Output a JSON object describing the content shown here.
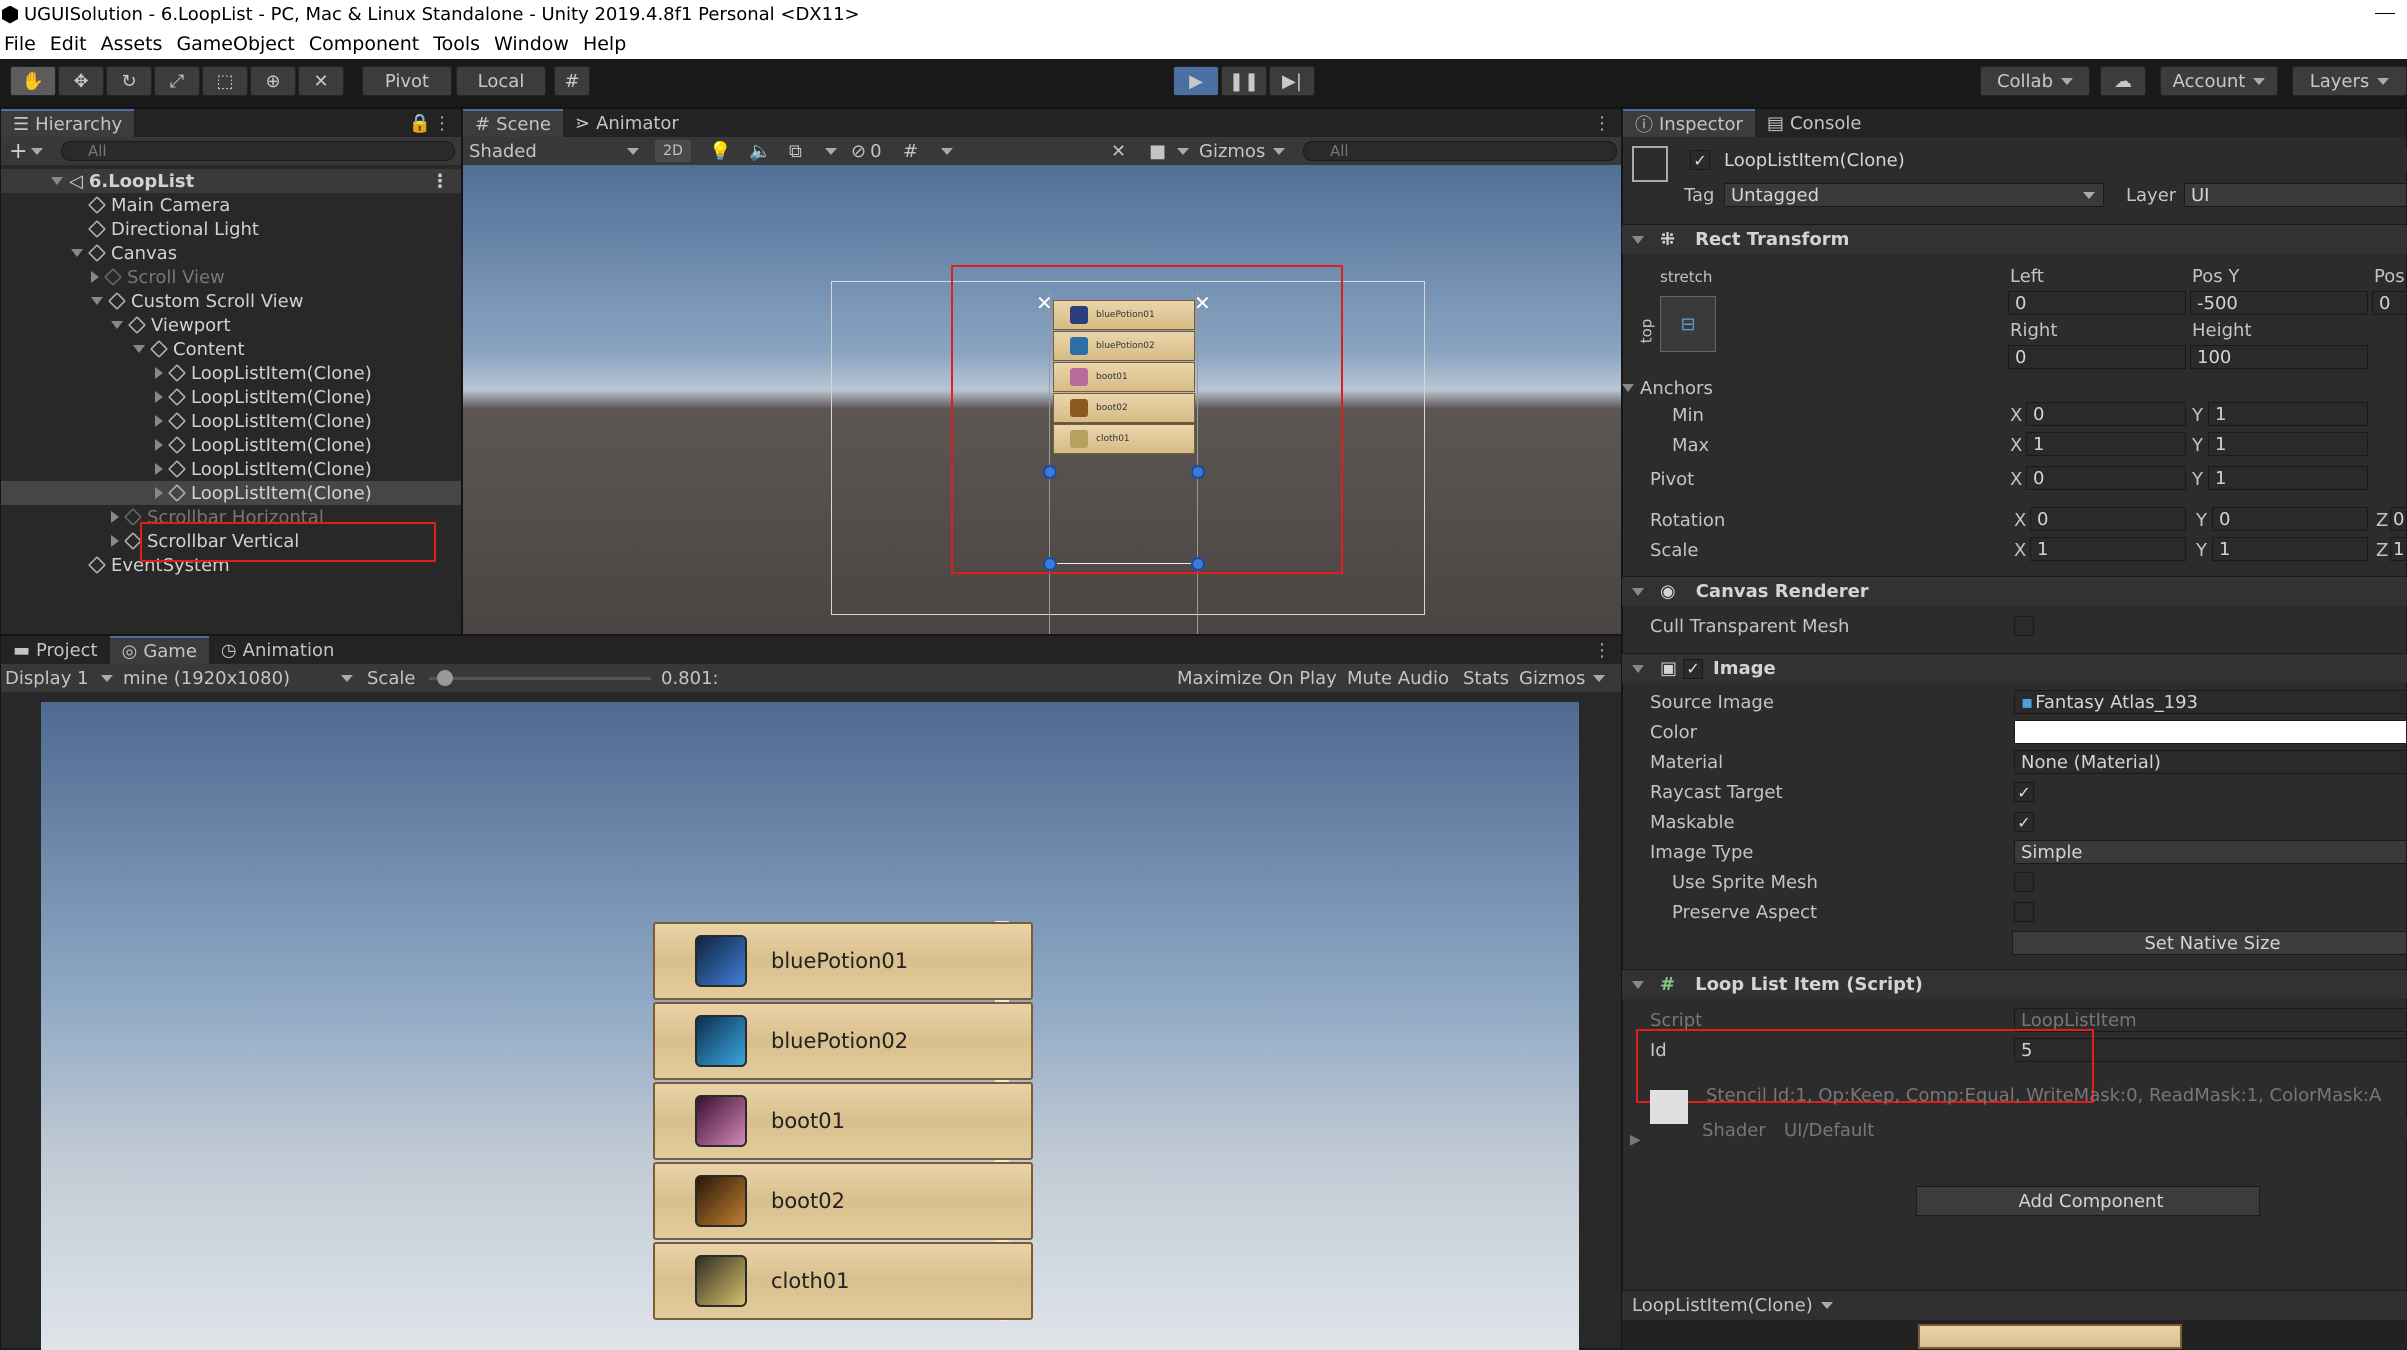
{
  "window": {
    "title": "UGUISolution - 6.LoopList - PC, Mac & Linux Standalone - Unity 2019.4.8f1 Personal <DX11>"
  },
  "menu": [
    "File",
    "Edit",
    "Assets",
    "GameObject",
    "Component",
    "Tools",
    "Window",
    "Help"
  ],
  "toolbar": {
    "pivot": "Pivot",
    "local": "Local",
    "collab": "Collab",
    "account": "Account",
    "layers": "Layers"
  },
  "hierarchy": {
    "tab": "Hierarchy",
    "search_placeholder": "All",
    "items": [
      {
        "label": "6.LoopList",
        "depth": 0
      },
      {
        "label": "Main Camera",
        "depth": 1
      },
      {
        "label": "Directional Light",
        "depth": 1
      },
      {
        "label": "Canvas",
        "depth": 1
      },
      {
        "label": "Scroll View",
        "depth": 2
      },
      {
        "label": "Custom Scroll View",
        "depth": 2
      },
      {
        "label": "Viewport",
        "depth": 3
      },
      {
        "label": "Content",
        "depth": 4
      },
      {
        "label": "LoopListItem(Clone)",
        "depth": 5
      },
      {
        "label": "LoopListItem(Clone)",
        "depth": 5
      },
      {
        "label": "LoopListItem(Clone)",
        "depth": 5
      },
      {
        "label": "LoopListItem(Clone)",
        "depth": 5
      },
      {
        "label": "LoopListItem(Clone)",
        "depth": 5
      },
      {
        "label": "LoopListItem(Clone)",
        "depth": 5
      },
      {
        "label": "Scrollbar Horizontal",
        "depth": 3
      },
      {
        "label": "Scrollbar Vertical",
        "depth": 3
      },
      {
        "label": "EventSystem",
        "depth": 1
      }
    ]
  },
  "scene": {
    "tab_scene": "Scene",
    "tab_animator": "Animator",
    "shading": "Shaded",
    "mode2d": "2D",
    "hidden_count": "0",
    "gizmos": "Gizmos",
    "search_placeholder": "All"
  },
  "bottom": {
    "tab_project": "Project",
    "tab_game": "Game",
    "tab_animation": "Animation",
    "display": "Display 1",
    "resolution": "mine (1920x1080)",
    "scale_label": "Scale",
    "scale_value": "0.801:",
    "scale_fraction": 0.07,
    "maximize": "Maximize On Play",
    "mute": "Mute Audio",
    "stats": "Stats",
    "gizmos": "Gizmos"
  },
  "list_items": [
    "bluePotion01",
    "bluePotion02",
    "boot01",
    "boot02",
    "cloth01"
  ],
  "inspector": {
    "tab_inspector": "Inspector",
    "tab_console": "Console",
    "object_name": "LoopListItem(Clone)",
    "tag_label": "Tag",
    "tag_value": "Untagged",
    "layer_label": "Layer",
    "layer_value": "UI",
    "rect_transform": "Rect Transform",
    "stretch": "stretch",
    "top": "top",
    "left_label": "Left",
    "posy_label": "Pos Y",
    "posz_label": "Pos",
    "left_value": "0",
    "posy_value": "-500",
    "posz_value": "0",
    "right_label": "Right",
    "height_label": "Height",
    "right_value": "0",
    "height_value": "100",
    "anchors": "Anchors",
    "min": "Min",
    "max": "Max",
    "pivot": "Pivot",
    "rotation": "Rotation",
    "scale": "Scale",
    "x": "X",
    "y": "Y",
    "z": "Z",
    "anchor_min_x": "0",
    "anchor_min_y": "1",
    "anchor_max_x": "1",
    "anchor_max_y": "1",
    "pivot_x": "0",
    "pivot_y": "1",
    "rot_x": "0",
    "rot_y": "0",
    "rot_z": "0",
    "scale_x": "1",
    "scale_y": "1",
    "scale_z": "1",
    "canvas_renderer": "Canvas Renderer",
    "cull_mesh": "Cull Transparent Mesh",
    "image": "Image",
    "source_image": "Source Image",
    "source_image_value": "Fantasy Atlas_193",
    "color": "Color",
    "material": "Material",
    "material_value": "None (Material)",
    "raycast": "Raycast Target",
    "maskable": "Maskable",
    "image_type": "Image Type",
    "image_type_value": "Simple",
    "use_sprite_mesh": "Use Sprite Mesh",
    "preserve_aspect": "Preserve Aspect",
    "set_native_size": "Set Native Size",
    "loop_script": "Loop List Item (Script)",
    "script_label": "Script",
    "script_value": "LoopListItem",
    "id_label": "Id",
    "id_value": "5",
    "stencil": "Stencil Id:1, Op:Keep, Comp:Equal, WriteMask:0, ReadMask:1, ColorMask:A",
    "shader_label": "Shader",
    "shader_value": "UI/Default",
    "add_component": "Add Component",
    "preview_name": "LoopListItem(Clone)"
  }
}
